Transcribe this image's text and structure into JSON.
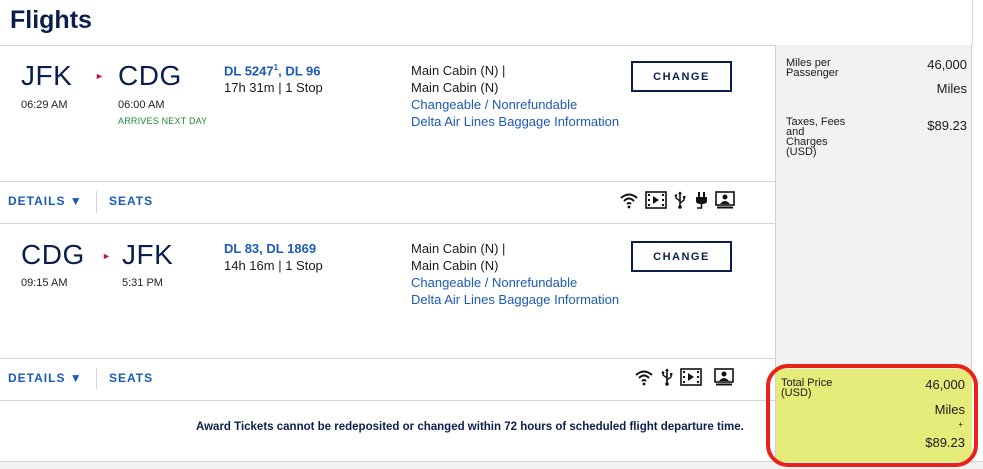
{
  "page": {
    "title": "Flights"
  },
  "segments": [
    {
      "origin": "JFK",
      "origin_time": "06:29 AM",
      "destination": "CDG",
      "destination_time": "06:00 AM",
      "arrives_note": "ARRIVES NEXT DAY",
      "flight_a": "DL 5247",
      "flight_a_sup": "1",
      "flight_sep": ",",
      "flight_b": "DL 96",
      "duration": "17h 31m | 1 Stop",
      "cabin_line1": "Main Cabin (N) |",
      "cabin_line2": "Main Cabin (N)",
      "fare_rules": "Changeable / Nonrefundable",
      "baggage": "Delta Air Lines Baggage Information",
      "change_label": "CHANGE",
      "details_label": "DETAILS ▼",
      "seats_label": "SEATS",
      "amenities": [
        "wifi-icon",
        "entertainment-icon",
        "usb-power-icon",
        "ac-power-icon",
        "personal-screen-icon"
      ]
    },
    {
      "origin": "CDG",
      "origin_time": "09:15 AM",
      "destination": "JFK",
      "destination_time": "5:31 PM",
      "flight_a": "DL 83",
      "flight_sep": ",",
      "flight_b": "DL 1869",
      "duration": "14h 16m | 1 Stop",
      "cabin_line1": "Main Cabin (N) |",
      "cabin_line2": "Main Cabin (N)",
      "fare_rules": "Changeable / Nonrefundable",
      "baggage": "Delta Air Lines Baggage Information",
      "change_label": "CHANGE",
      "details_label": "DETAILS ▼",
      "seats_label": "SEATS",
      "amenities": [
        "wifi-icon",
        "usb-power-icon",
        "entertainment-icon",
        "personal-screen-icon"
      ]
    }
  ],
  "notice": "Award Tickets cannot be redeposited or changed within 72 hours of scheduled flight departure time.",
  "pricing": {
    "miles_label_1": "Miles per",
    "miles_label_2": "Passenger",
    "miles_value": "46,000",
    "miles_unit": "Miles",
    "taxes_label_1": "Taxes, Fees",
    "taxes_label_2": "and",
    "taxes_label_3": "Charges",
    "taxes_label_4": "(USD)",
    "taxes_value": "$89.23",
    "total_label_1": "Total Price",
    "total_label_2": "(USD)",
    "total_miles": "46,000",
    "total_unit": "Miles",
    "total_plus": "+",
    "total_cash": "$89.23"
  },
  "colors": {
    "brand_navy": "#0b1f4f",
    "link_blue": "#1b5ab8",
    "highlight_yellow": "#e6ec79",
    "annotation_red": "#e8221b",
    "arrow_red": "#c01933"
  }
}
